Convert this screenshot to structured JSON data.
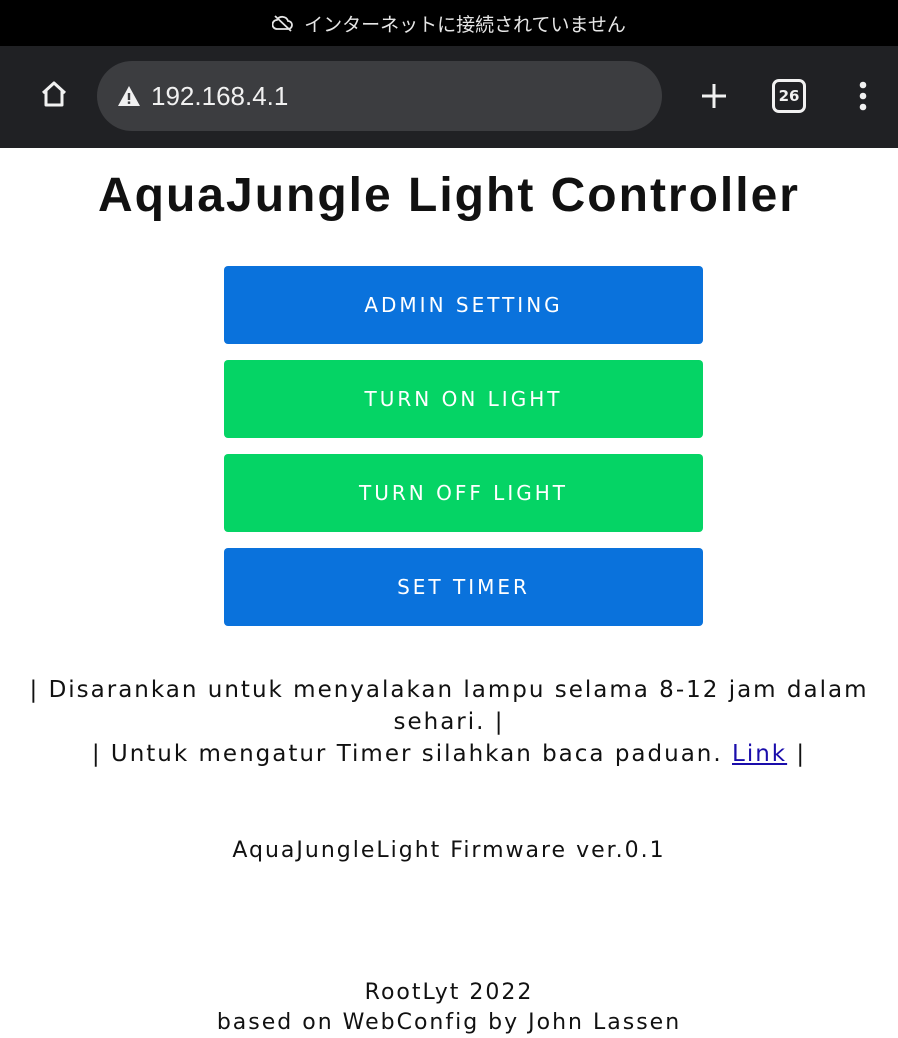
{
  "status_bar": {
    "message": "インターネットに接続されていません",
    "icon": "cloud-off-icon"
  },
  "browser": {
    "url": "192.168.4.1",
    "tab_count": "26",
    "icons": [
      "home-icon",
      "warning-icon",
      "plus-icon",
      "tabs-icon",
      "more-vert-icon"
    ]
  },
  "page": {
    "title": "AquaJungle Light Controller",
    "buttons": {
      "admin": "ADMIN SETTING",
      "turn_on": "TURN ON LIGHT",
      "turn_off": "TURN OFF LIGHT",
      "timer": "SET TIMER"
    },
    "info": {
      "line1": "| Disarankan untuk menyalakan lampu selama 8-12 jam dalam sehari. |",
      "line2_prefix": "| Untuk mengatur Timer silahkan baca paduan. ",
      "link": "Link",
      "line2_suffix": " |"
    },
    "firmware": "AquaJungleLight Firmware ver.0.1",
    "credits": {
      "line1": "RootLyt 2022",
      "line2": "based on WebConfig by John Lassen"
    }
  },
  "colors": {
    "primary_blue": "#0a72dc",
    "success_green": "#05d465",
    "browser_bg": "#202124",
    "link": "#1a0dab"
  }
}
